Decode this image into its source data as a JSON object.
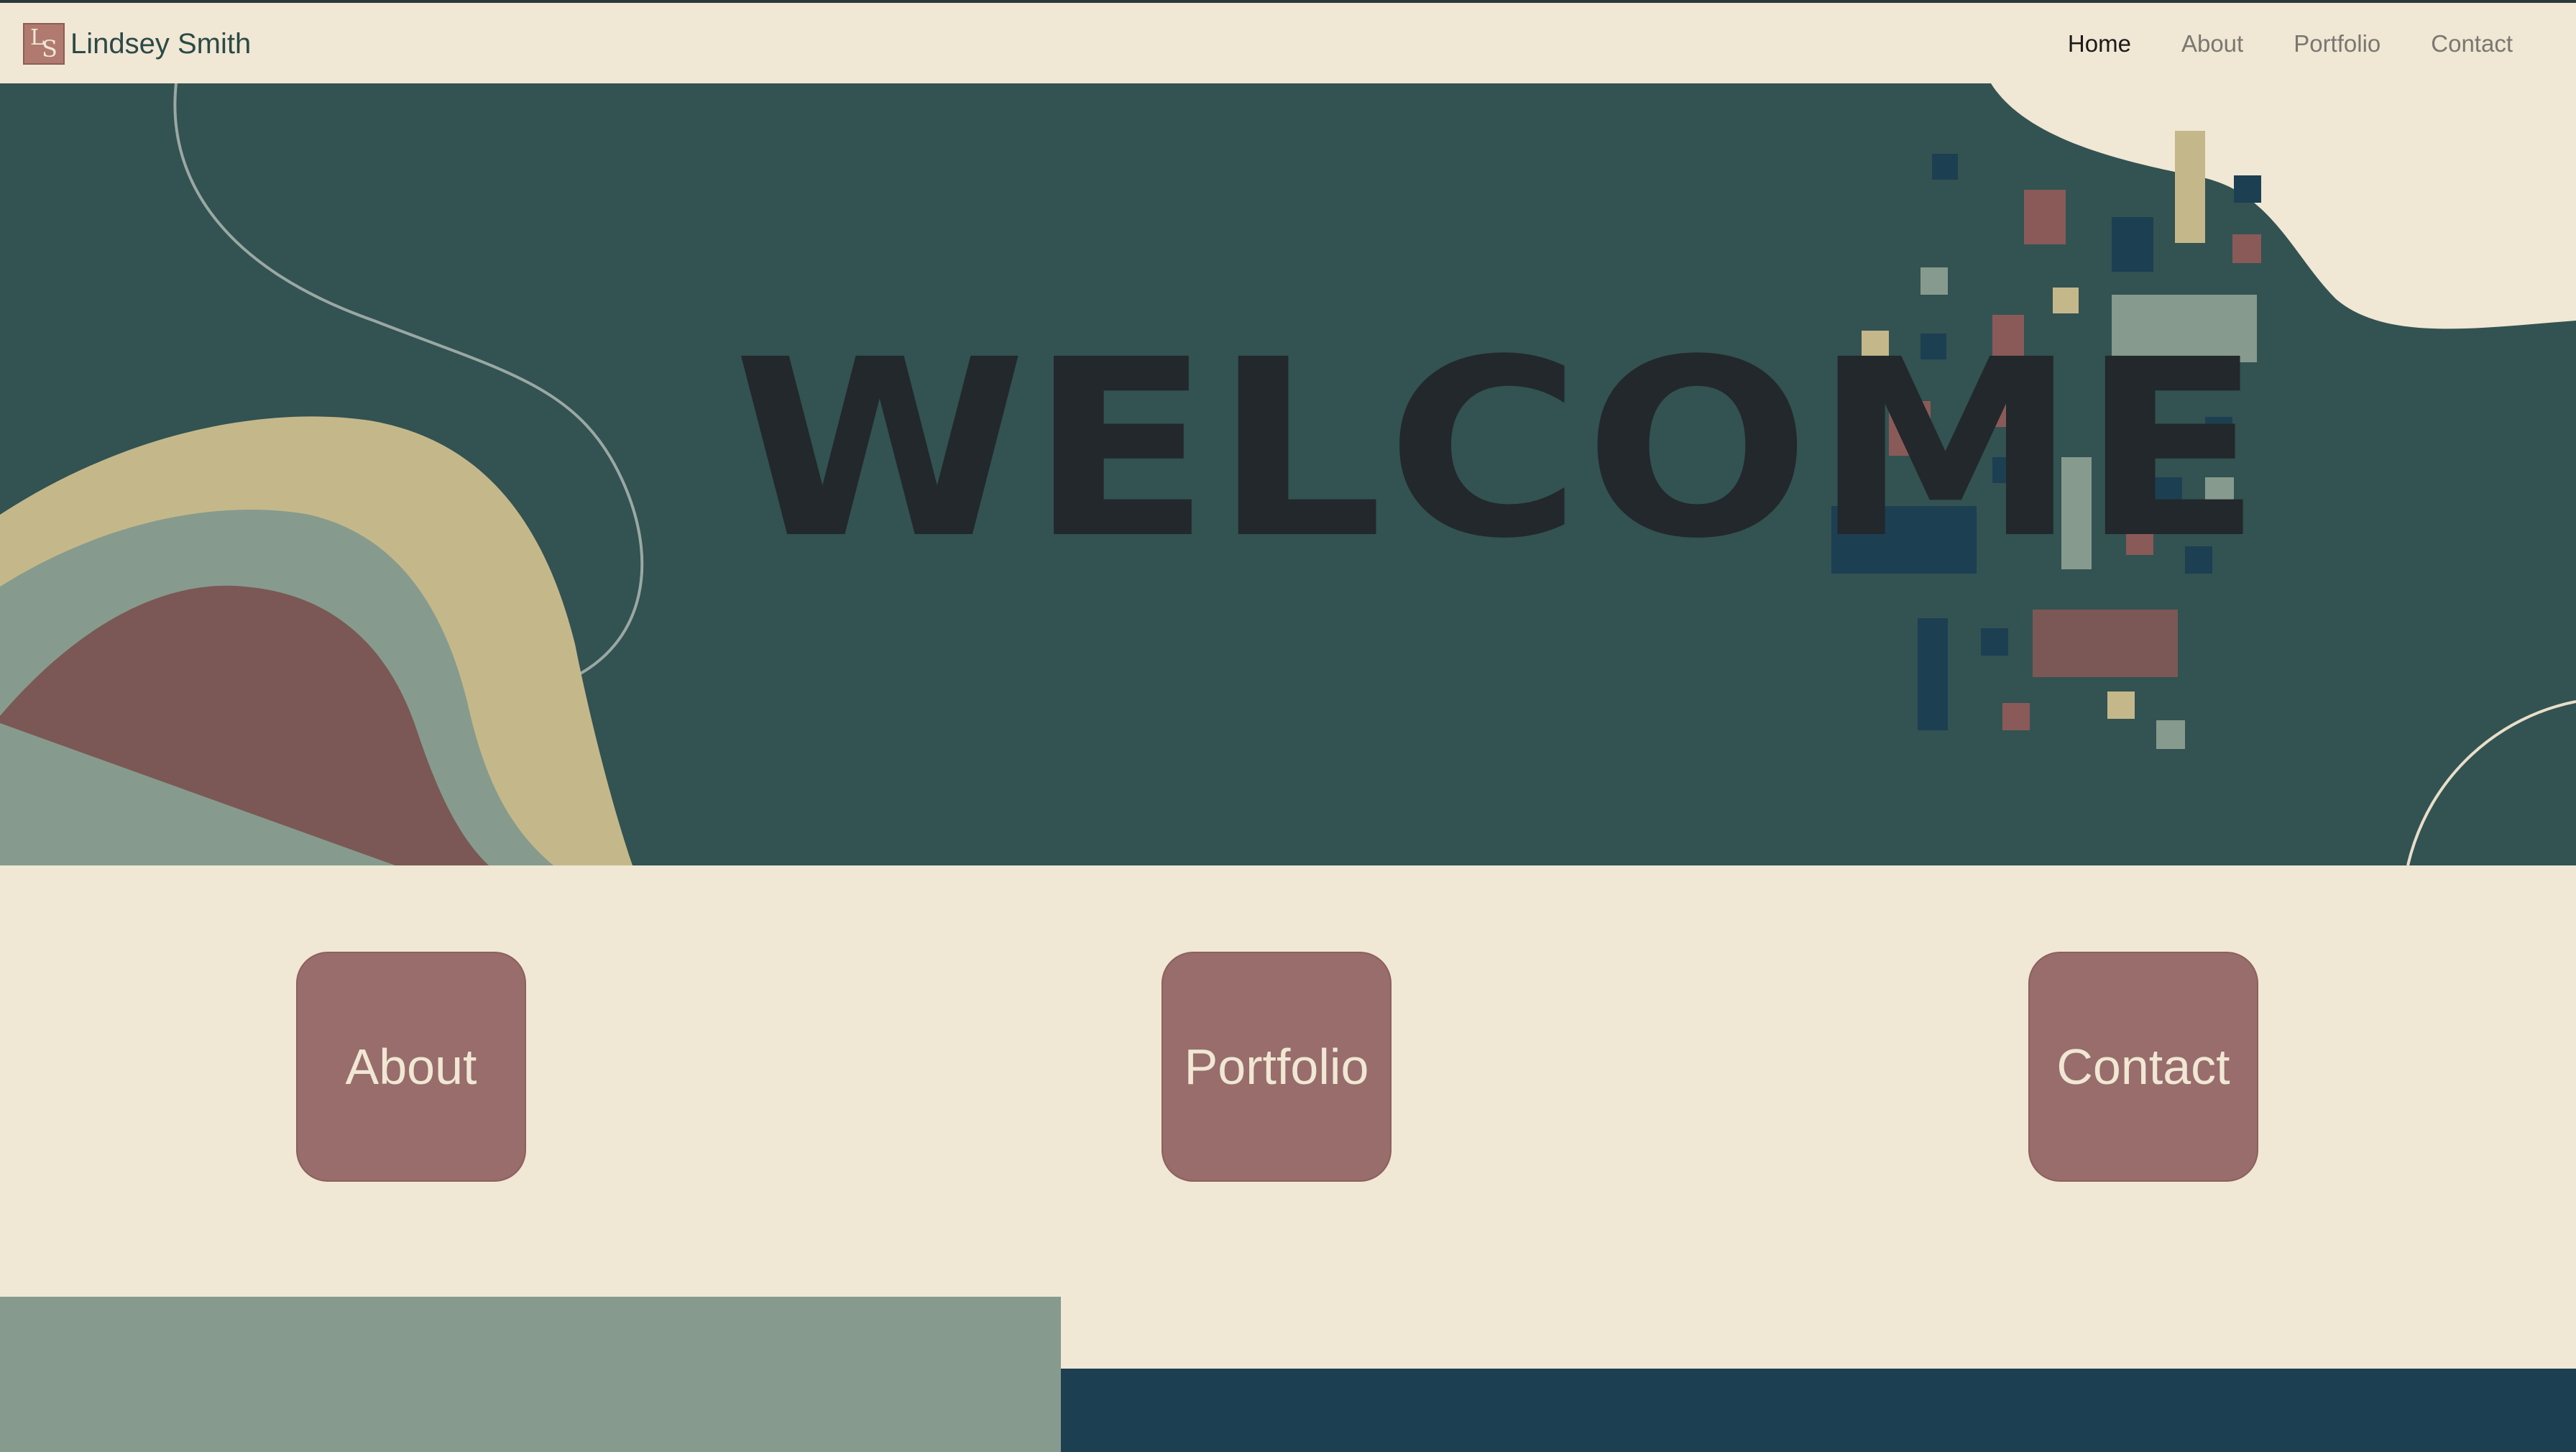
{
  "navbar": {
    "brand_initials_1": "L",
    "brand_initials_2": "S",
    "brand_name": "Lindsey Smith",
    "links": [
      {
        "label": "Home",
        "active": true
      },
      {
        "label": "About",
        "active": false
      },
      {
        "label": "Portfolio",
        "active": false
      },
      {
        "label": "Contact",
        "active": false
      }
    ]
  },
  "hero": {
    "title": "WELCOME"
  },
  "cards": {
    "about": "About",
    "portfolio": "Portfolio",
    "contact": "Contact"
  },
  "colors": {
    "cream": "#f0e7d4",
    "teal_dark": "#335252",
    "sage": "#869b8d",
    "mauve": "#986d6b",
    "tan": "#c4b88a",
    "navy": "#1c3f52",
    "rose_dark": "#7b5855"
  }
}
